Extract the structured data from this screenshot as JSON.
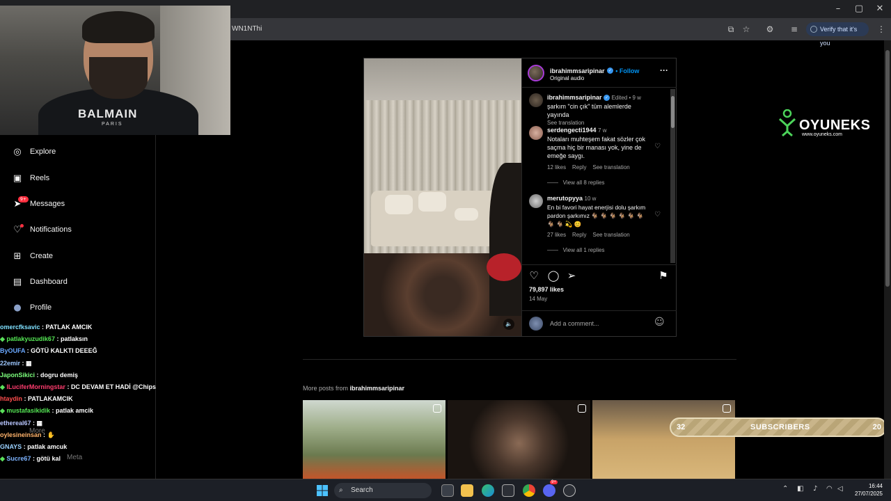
{
  "browser": {
    "url_fragment": "WN1NThi",
    "verify_label": "Verify that it's you",
    "win_min": "–",
    "win_max": "▢",
    "win_close": "✕"
  },
  "webcam": {
    "shirt_brand": "BALMAIN",
    "shirt_sub": "PARIS"
  },
  "sidebar": {
    "items": [
      {
        "label": "Explore",
        "icon": "compass-icon",
        "glyph": "◎"
      },
      {
        "label": "Reels",
        "icon": "reels-icon",
        "glyph": "▣"
      },
      {
        "label": "Messages",
        "icon": "messages-icon",
        "glyph": "➤",
        "badge": "9+"
      },
      {
        "label": "Notifications",
        "icon": "heart-icon",
        "glyph": "♡"
      },
      {
        "label": "Create",
        "icon": "plus-icon",
        "glyph": "⊞"
      },
      {
        "label": "Dashboard",
        "icon": "dashboard-icon",
        "glyph": "▤"
      },
      {
        "label": "Profile",
        "icon": "profile-icon",
        "glyph": "●"
      }
    ],
    "more_label": "More",
    "meta_label": "Meta"
  },
  "chat": [
    {
      "user": "omercfksavic",
      "color": "#7fe0ff",
      "msg": "PATLAK AMCIK",
      "sub": false
    },
    {
      "user": "patlakyuzudik67",
      "color": "#55e855",
      "msg": "patlaksın",
      "sub": true
    },
    {
      "user": "ByOUFA",
      "color": "#6aa8ff",
      "msg": "GÖTÜ KALKTI DEEEĞ",
      "sub": false
    },
    {
      "user": "22emir",
      "color": "#9ec8ff",
      "msg": "▦",
      "sub": false
    },
    {
      "user": "JaponSikici",
      "color": "#7dff7d",
      "msg": "dogru demiş",
      "sub": false
    },
    {
      "user": "lLuciferMorningstar",
      "color": "#ff3c6e",
      "msg": "DC DEVAM ET HADİ @Chips",
      "sub": true
    },
    {
      "user": "htaydin",
      "color": "#ff4d4d",
      "msg": "PATLAKAMCIK",
      "sub": false
    },
    {
      "user": "mustafasikidik",
      "color": "#55e855",
      "msg": "patlak amcik",
      "sub": true
    },
    {
      "user": "ethereal67",
      "color": "#b9c6ff",
      "msg": "▦",
      "sub": false
    },
    {
      "user": "oylesineinsan",
      "color": "#ffb36b",
      "msg": "✋",
      "sub": false
    },
    {
      "user": "GNAYS",
      "color": "#9ad1ff",
      "msg": "patlak amcuk",
      "sub": false
    },
    {
      "user": "Sucre67",
      "color": "#7db3ff",
      "msg": "götü kal",
      "sub": true
    }
  ],
  "post": {
    "author": "ibrahimmsaripinar",
    "follow": "Follow",
    "audio": "Original audio",
    "more_glyph": "···",
    "comments": [
      {
        "user": "ibrahimmsaripinar",
        "verified": true,
        "meta": "Edited • 9 w",
        "text": "şarkım \"cin çık\" tüm alemlerde yayında",
        "footer": "See translation",
        "heart": false
      },
      {
        "user": "serdengecti1944",
        "verified": false,
        "meta": "7 w",
        "text": "Notaları muhteşem fakat sözler çok saçma hiç bir manası yok, yine de emeğe saygı.",
        "footer": "12 likes    Reply    See translation",
        "replies": "View all 8 replies",
        "heart": true
      },
      {
        "user": "merutopyya",
        "verified": false,
        "meta": "10 w",
        "text": "En bi favori hayat enerjisi dolu şarkım pardon şarkımız 🐐 🐐 🐐 🐐 🐐 🐐 🐐 🐐 💫 😊",
        "footer": "27 likes    Reply    See translation",
        "replies": "View all 1 replies",
        "heart": true
      }
    ],
    "likes": "79,897 likes",
    "date": "14 May",
    "add_comment": "Add a comment..."
  },
  "more_posts": {
    "prefix": "More posts from ",
    "user": "ibrahimmsaripinar"
  },
  "overlay": {
    "brand": "OYUNEKS",
    "brand_url": "www.oyuneks.com",
    "subs_left": "32",
    "subs_label": "SUBSCRIBERS",
    "subs_right": "20"
  },
  "taskbar": {
    "search": "Search",
    "time": "16:44",
    "date": "27/07/2025",
    "chrome_badge": "9+"
  }
}
